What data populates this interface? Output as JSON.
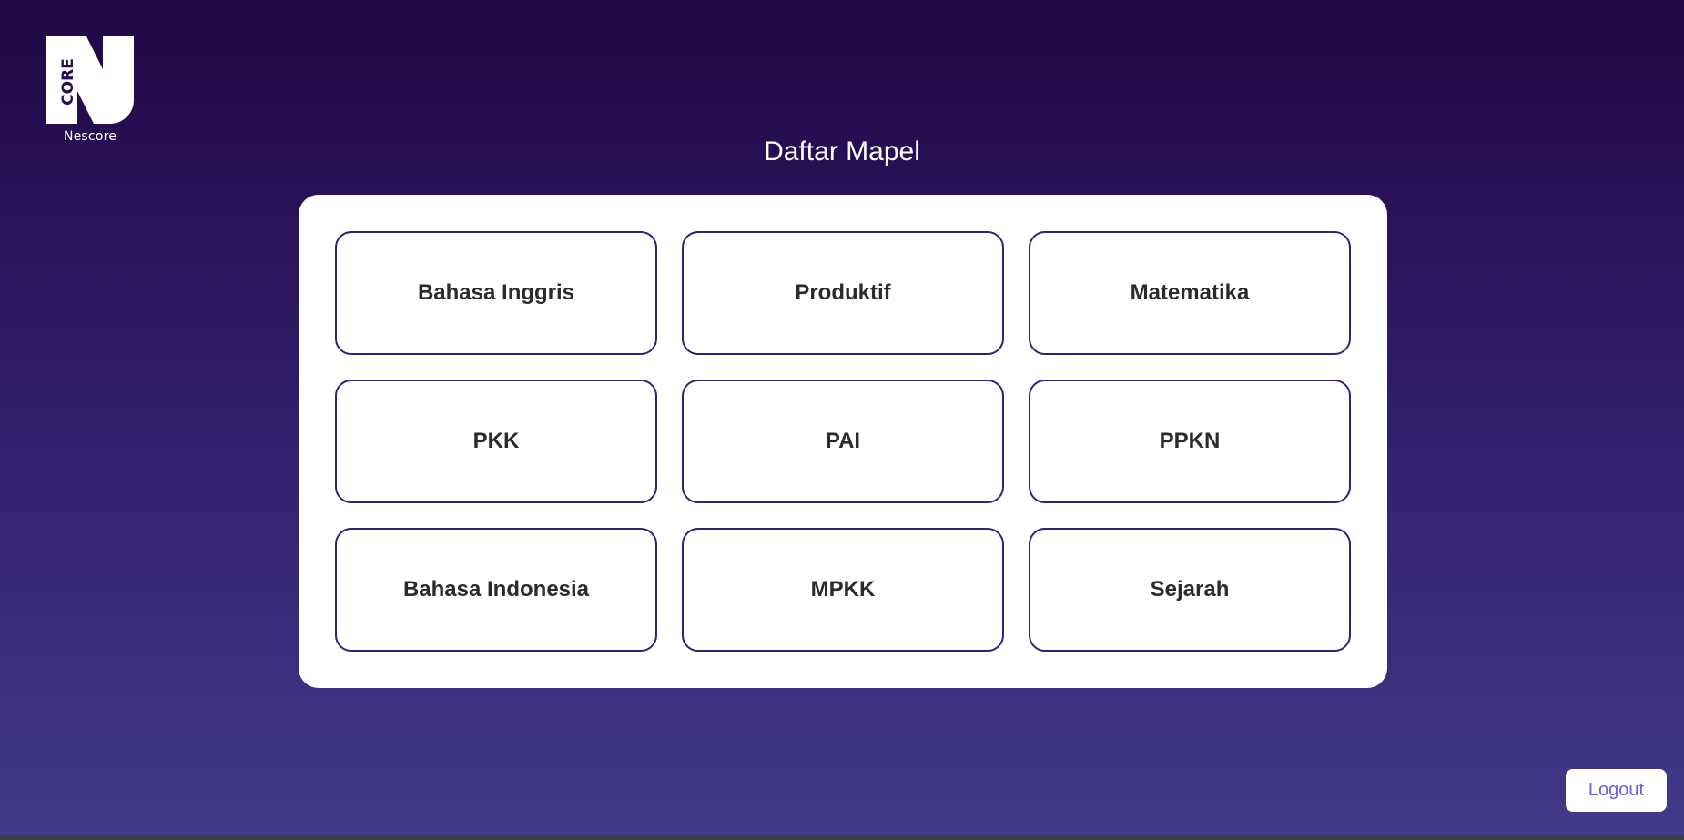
{
  "brand": {
    "logo_text": "CORE",
    "name": "Nescore",
    "logo_icon": "n-core-logo-icon"
  },
  "page": {
    "title": "Daftar Mapel"
  },
  "subjects": [
    {
      "label": "Bahasa Inggris"
    },
    {
      "label": "Produktif"
    },
    {
      "label": "Matematika"
    },
    {
      "label": "PKK"
    },
    {
      "label": "PAI"
    },
    {
      "label": "PPKN"
    },
    {
      "label": "Bahasa Indonesia"
    },
    {
      "label": "MPKK"
    },
    {
      "label": "Sejarah"
    }
  ],
  "actions": {
    "logout_label": "Logout"
  },
  "colors": {
    "background_top": "#1f0845",
    "background_bottom": "#423a8a",
    "button_border": "#2d2475",
    "logout_text": "#6c5fe0"
  }
}
